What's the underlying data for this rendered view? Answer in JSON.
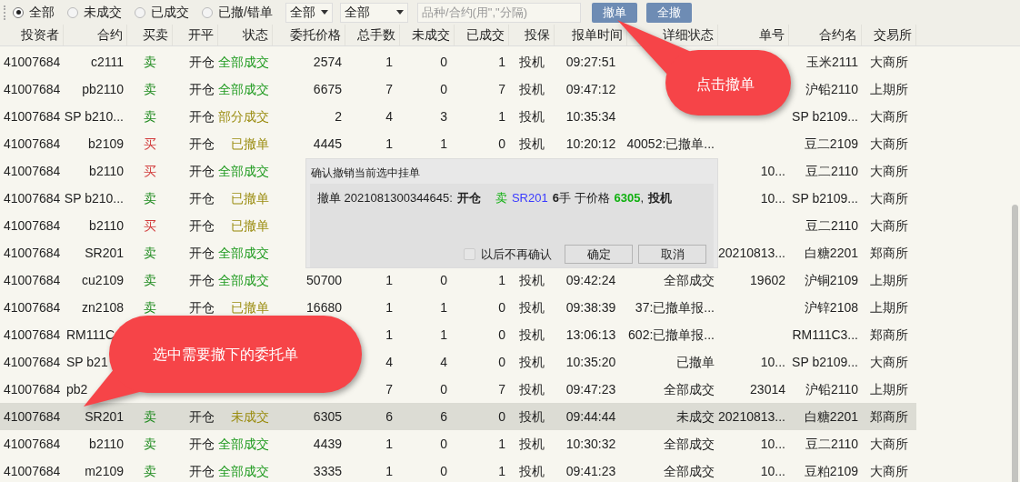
{
  "toolbar": {
    "filters": [
      {
        "label": "全部",
        "selected": true
      },
      {
        "label": "未成交",
        "selected": false
      },
      {
        "label": "已成交",
        "selected": false
      },
      {
        "label": "已撤/错单",
        "selected": false
      }
    ],
    "dropdowns": [
      "全部",
      "全部"
    ],
    "search": {
      "placeholder": "品种/合约(用\",\"分隔)"
    },
    "buttons": [
      "撤单",
      "全撤"
    ]
  },
  "table": {
    "columns": [
      "投资者",
      "合约",
      "买卖",
      "开平",
      "状态",
      "委托价格",
      "总手数",
      "未成交",
      "已成交",
      "投保",
      "报单时间",
      "详细状态",
      "单号",
      "合约名",
      "交易所"
    ],
    "rows": [
      {
        "selected": false,
        "cells": [
          "41007684",
          "c2111",
          {
            "text": "卖",
            "color": "#1e8a1e"
          },
          "开仓",
          {
            "text": "全部成交",
            "color": "#1e9a1e"
          },
          "2574",
          "1",
          "0",
          "1",
          "投机",
          "09:27:51",
          null,
          null,
          "玉米2111",
          "大商所"
        ]
      },
      {
        "selected": false,
        "cells": [
          "41007684",
          "pb2110",
          {
            "text": "卖",
            "color": "#1e8a1e"
          },
          "开仓",
          {
            "text": "全部成交",
            "color": "#1e9a1e"
          },
          "6675",
          "7",
          "0",
          "7",
          "投机",
          "09:47:12",
          null,
          null,
          "沪铅2110",
          "上期所"
        ]
      },
      {
        "selected": false,
        "cells": [
          "41007684",
          "SP b210...",
          {
            "text": "卖",
            "color": "#1e8a1e"
          },
          "开仓",
          {
            "text": "部分成交",
            "color": "#9a8c10"
          },
          "2",
          "4",
          "3",
          "1",
          "投机",
          "10:35:34",
          null,
          null,
          "SP b2109...",
          "大商所"
        ]
      },
      {
        "selected": false,
        "cells": [
          "41007684",
          "b2109",
          {
            "text": "买",
            "color": "#d23c3c"
          },
          "开仓",
          {
            "text": "已撤单",
            "color": "#9a8c10"
          },
          "4445",
          "1",
          "1",
          "0",
          "投机",
          "10:20:12",
          "40052:已撤单...",
          null,
          "豆二2109",
          "大商所"
        ]
      },
      {
        "selected": false,
        "cells": [
          "41007684",
          "b2110",
          {
            "text": "买",
            "color": "#d23c3c"
          },
          "开仓",
          {
            "text": "全部成交",
            "color": "#1e9a1e"
          },
          null,
          null,
          null,
          null,
          null,
          null,
          null,
          "10...",
          "豆二2110",
          "大商所"
        ]
      },
      {
        "selected": false,
        "cells": [
          "41007684",
          "SP b210...",
          {
            "text": "卖",
            "color": "#1e8a1e"
          },
          "开仓",
          {
            "text": "已撤单",
            "color": "#9a8c10"
          },
          null,
          null,
          null,
          null,
          null,
          null,
          null,
          "10...",
          "SP b2109...",
          "大商所"
        ]
      },
      {
        "selected": false,
        "cells": [
          "41007684",
          "b2110",
          {
            "text": "买",
            "color": "#d23c3c"
          },
          "开仓",
          {
            "text": "已撤单",
            "color": "#9a8c10"
          },
          null,
          null,
          null,
          null,
          null,
          null,
          null,
          null,
          "豆二2110",
          "大商所"
        ]
      },
      {
        "selected": false,
        "cells": [
          "41007684",
          "SR201",
          {
            "text": "卖",
            "color": "#1e8a1e"
          },
          "开仓",
          {
            "text": "全部成交",
            "color": "#1e9a1e"
          },
          null,
          null,
          null,
          null,
          null,
          null,
          null,
          "20210813...",
          "白糖2201",
          "郑商所"
        ]
      },
      {
        "selected": false,
        "cells": [
          "41007684",
          "cu2109",
          {
            "text": "卖",
            "color": "#1e8a1e"
          },
          "开仓",
          {
            "text": "全部成交",
            "color": "#1e9a1e"
          },
          "50700",
          "1",
          "0",
          "1",
          "投机",
          "09:42:24",
          "全部成交",
          "19602",
          "沪铜2109",
          "上期所"
        ]
      },
      {
        "selected": false,
        "cells": [
          "41007684",
          "zn2108",
          {
            "text": "卖",
            "color": "#1e8a1e"
          },
          "开仓",
          {
            "text": "已撤单",
            "color": "#9a8c10"
          },
          "16680",
          "1",
          "1",
          "0",
          "投机",
          "09:38:39",
          "37:已撤单报...",
          null,
          "沪锌2108",
          "上期所"
        ]
      },
      {
        "selected": false,
        "cells": [
          "41007684",
          {
            "text": "RM111C",
            "kind": "cut"
          },
          null,
          null,
          null,
          null,
          "1",
          "1",
          "0",
          "投机",
          "13:06:13",
          "602:已撤单报...",
          null,
          "RM111C3...",
          "郑商所"
        ]
      },
      {
        "selected": false,
        "cells": [
          "41007684",
          {
            "text": "SP b21",
            "kind": "cut"
          },
          null,
          null,
          null,
          null,
          "4",
          "4",
          "0",
          "投机",
          "10:35:20",
          "已撤单",
          "10...",
          "SP b2109...",
          "大商所"
        ]
      },
      {
        "selected": false,
        "cells": [
          "41007684",
          {
            "text": "pb2",
            "kind": "cut"
          },
          null,
          null,
          null,
          null,
          "7",
          "0",
          "7",
          "投机",
          "09:47:23",
          "全部成交",
          "23014",
          "沪铅2110",
          "上期所"
        ]
      },
      {
        "selected": true,
        "cells": [
          "41007684",
          "SR201",
          {
            "text": "卖",
            "color": "#1e8a1e"
          },
          "开仓",
          {
            "text": "未成交",
            "color": "#9a8c10"
          },
          "6305",
          "6",
          "6",
          "0",
          "投机",
          "09:44:44",
          "未成交",
          "20210813...",
          "白糖2201",
          "郑商所"
        ]
      },
      {
        "selected": false,
        "cells": [
          "41007684",
          "b2110",
          {
            "text": "卖",
            "color": "#1e8a1e"
          },
          "开仓",
          {
            "text": "全部成交",
            "color": "#1e9a1e"
          },
          "4439",
          "1",
          "0",
          "1",
          "投机",
          "10:30:32",
          "全部成交",
          "10...",
          "豆二2110",
          "大商所"
        ]
      },
      {
        "selected": false,
        "cells": [
          "41007684",
          "m2109",
          {
            "text": "卖",
            "color": "#1e8a1e"
          },
          "开仓",
          {
            "text": "全部成交",
            "color": "#1e9a1e"
          },
          "3335",
          "1",
          "0",
          "1",
          "投机",
          "09:41:23",
          "全部成交",
          "10...",
          "豆粕2109",
          "大商所"
        ]
      }
    ]
  },
  "dialog": {
    "title": "确认撤销当前选中挂单",
    "message": [
      {
        "kind": "plain",
        "text": "撤单 2021081300344645:"
      },
      {
        "kind": "bold",
        "text": "开仓"
      },
      {
        "kind": "side",
        "text": "卖"
      },
      {
        "kind": "blue",
        "text": "SR201"
      },
      {
        "kind": "bold",
        "text": "6"
      },
      {
        "kind": "tight",
        "text": "手 于价格"
      },
      {
        "kind": "green",
        "text": "6305"
      },
      {
        "kind": "tight",
        "text": ","
      },
      {
        "kind": "bold",
        "text": "投机"
      }
    ],
    "checkbox": {
      "label": "以后不再确认",
      "checked": false
    },
    "buttons": [
      "确定",
      "取消"
    ]
  },
  "callouts": [
    "点击撤单",
    "选中需要撤下的委托单"
  ]
}
